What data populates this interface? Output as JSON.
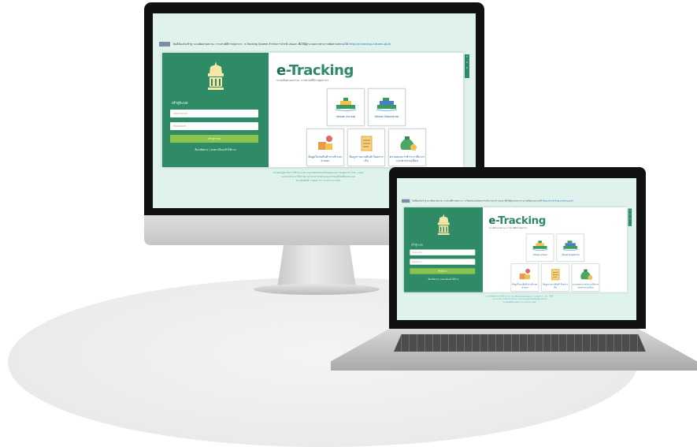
{
  "notice": {
    "text": "ยินดีต้อนรับเข้าสู่ ระบบติดตามสถานะ การผ่านพิธีการศุลกากร : e-Tracking System สำหรับการนำเข้า-ส่งออก เพื่อให้ผู้ประกอบการสามารถติดตามสถานะได้ ",
    "link_text": "https://e-tracking.customs.go.th"
  },
  "side_tabs": [
    "ก",
    "ก",
    "ก"
  ],
  "brand": {
    "name_e": "e",
    "name_rest": "-Tracking",
    "subtitle": "ระบบติดตามสถานะ การผ่านพิธีการศุลกากร"
  },
  "login": {
    "title": "เข้าสู่ระบบ",
    "username_placeholder": "Username",
    "password_placeholder": "Password",
    "button": "เข้าสู่ระบบ",
    "links": "ลืมรหัสผ่าน | ลงทะเบียนเข้าใช้งาน"
  },
  "tiles": {
    "arrival": "Vessel Arrival",
    "departure": "Vessel Departure",
    "cargo": "ข้อมูลใบขนสินค้าขาเข้าและขาออก",
    "manifest": "ข้อมูลรายงานสินค้าโดยสารเรือ",
    "payment": "ตรวจสอบการชำระภาษีอากรและค่าธรรมเนียม"
  },
  "footer": [
    "หากพบปัญหาในการใช้งานระบบ กรุณาติดต่อฝ่ายสนับสนุนระบบ กรมศุลกากร โทร. 1164",
    "ระบบรองรับการใช้งานผ่านเว็บเบราว์เซอร์และอุปกรณ์เคลื่อนที่ทุกประเภท",
    "สงวนลิขสิทธิ์ กรมศุลกากร กระทรวงการคลัง"
  ],
  "colors": {
    "primary": "#2e8b65",
    "button": "#8ac44e",
    "screen_bg": "#dff3ec",
    "link": "#2a64c8"
  }
}
